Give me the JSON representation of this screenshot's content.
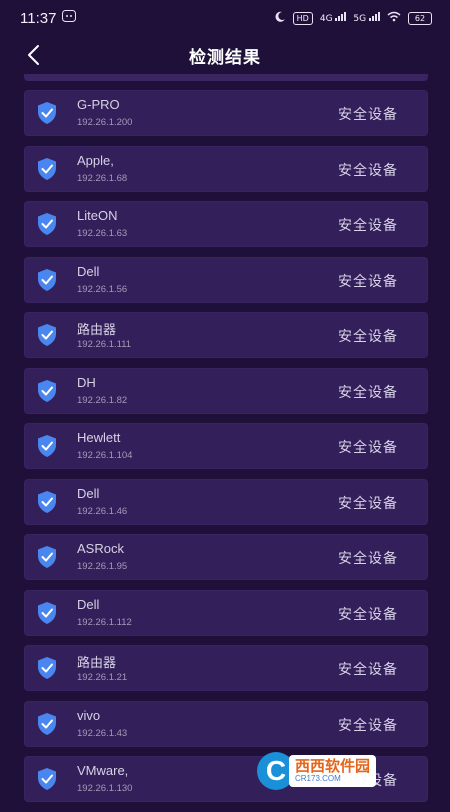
{
  "status_bar": {
    "time": "11:37",
    "left_icons": [
      "wechat-icon"
    ],
    "right_icons": [
      "moon-icon",
      "hd-icon",
      "signal-4g-icon",
      "signal-5g-icon",
      "wifi-icon"
    ],
    "hd_label": "HD",
    "net1": "4G",
    "net2": "5G",
    "battery": "62"
  },
  "header": {
    "title": "检测结果",
    "back_icon": "chevron-left-icon"
  },
  "devices": [
    {
      "name": "G-PRO",
      "ip": "192.26.1.200",
      "status": "安全设备"
    },
    {
      "name": "Apple,",
      "ip": "192.26.1.68",
      "status": "安全设备"
    },
    {
      "name": "LiteON",
      "ip": "192.26.1.63",
      "status": "安全设备"
    },
    {
      "name": "Dell",
      "ip": "192.26.1.56",
      "status": "安全设备"
    },
    {
      "name": "路由器",
      "ip": "192.26.1.111",
      "status": "安全设备"
    },
    {
      "name": "DH",
      "ip": "192.26.1.82",
      "status": "安全设备"
    },
    {
      "name": "Hewlett",
      "ip": "192.26.1.104",
      "status": "安全设备"
    },
    {
      "name": "Dell",
      "ip": "192.26.1.46",
      "status": "安全设备"
    },
    {
      "name": "ASRock",
      "ip": "192.26.1.95",
      "status": "安全设备"
    },
    {
      "name": "Dell",
      "ip": "192.26.1.112",
      "status": "安全设备"
    },
    {
      "name": "路由器",
      "ip": "192.26.1.21",
      "status": "安全设备"
    },
    {
      "name": "vivo",
      "ip": "192.26.1.43",
      "status": "安全设备"
    },
    {
      "name": "VMware,",
      "ip": "192.26.1.130",
      "status": "安全设备"
    }
  ],
  "watermark": {
    "main": "西西软件园",
    "sub": "CR173.COM"
  },
  "colors": {
    "background": "#1e1038",
    "card": "#33205a",
    "shield": "#4a86f0"
  }
}
